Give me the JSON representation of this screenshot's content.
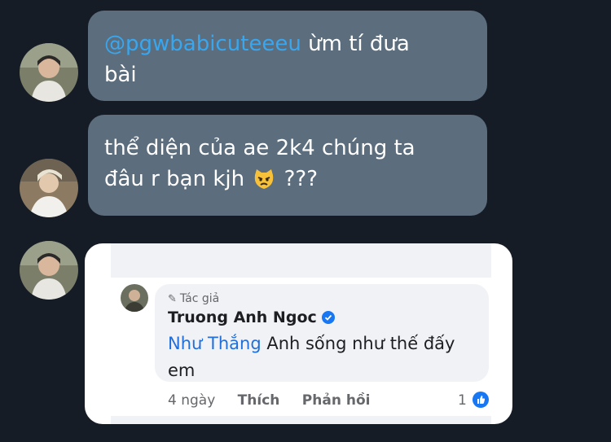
{
  "messages": [
    {
      "mention": "@pgwbabicuteeeu",
      "text_line1": " ừm tí đưa",
      "text_line2": "bài"
    },
    {
      "text_line1": "thể diện của ae 2k4 chúng ta",
      "text_line2_a": "đâu r bạn kjh ",
      "emoji": "angry-cat-emoji",
      "text_line2_b": " ???"
    }
  ],
  "fb_comment": {
    "author_tag": "Tác giả",
    "author_name": "Truong Anh Ngoc",
    "tagged_name": "Như Thắng",
    "text_rest": " Anh sống như thế đấy",
    "text_line2": "em",
    "time": "4 ngày",
    "like_label": "Thích",
    "reply_label": "Phản hồi",
    "like_count": "1"
  },
  "colors": {
    "background": "#151c25",
    "bubble": "#5c6d7d",
    "mention": "#39a6ee",
    "fb_blue": "#1877f2"
  }
}
